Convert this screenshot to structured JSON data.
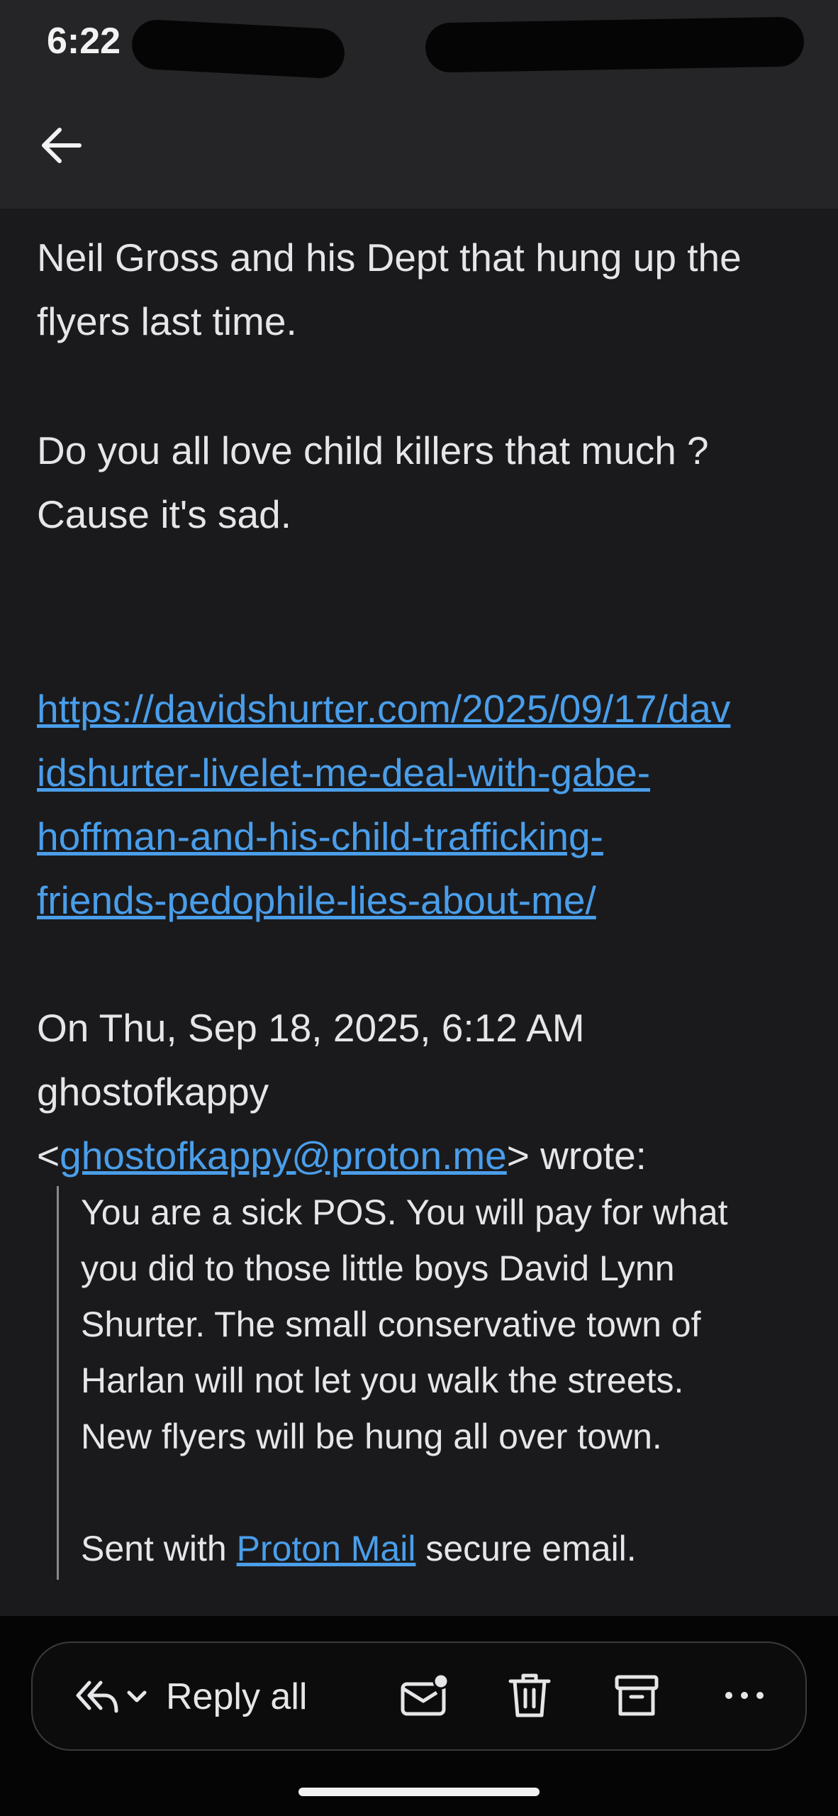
{
  "status_bar": {
    "time": "6:22"
  },
  "email": {
    "body_lines": [
      "Neil Gross and his Dept that hung up the",
      "flyers last time.",
      "Do you all love child killers that much ?",
      "Cause it's sad."
    ],
    "link_lines": [
      "https://davidshurter.com/2025/09/17/dav",
      "idshurter-livelet-me-deal-with-gabe-",
      "hoffman-and-his-child-trafficking-",
      "friends-pedophile-lies-about-me/"
    ],
    "quote_header": {
      "line1": "On Thu, Sep 18, 2025, 6:12 AM",
      "line2": "ghostofkappy",
      "open_bracket": "<",
      "email": "ghostofkappy@proton.me",
      "close": "> wrote:"
    },
    "quoted_lines": [
      "You are a sick POS.  You will pay for what",
      "you did to those little boys David Lynn",
      "Shurter.  The small conservative town of",
      "Harlan will not let you walk the streets.",
      "New flyers will be hung all over town."
    ],
    "signature": {
      "prefix": "Sent with ",
      "link": "Proton Mail",
      "suffix": " secure email."
    }
  },
  "toolbar": {
    "reply_all_label": "Reply all",
    "icons": [
      "reply-all-icon",
      "chevron-down-icon",
      "mark-unread-icon",
      "trash-icon",
      "archive-icon",
      "more-icon"
    ]
  },
  "colors": {
    "background": "#1a1a1c",
    "header": "#252527",
    "link": "#4a9eea",
    "toolbar": "#0c0c0d"
  }
}
